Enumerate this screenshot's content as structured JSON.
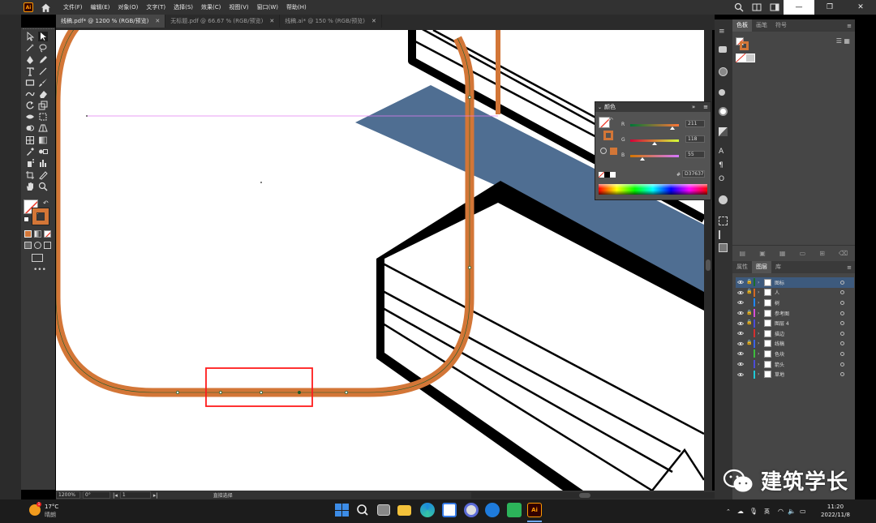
{
  "menubar": {
    "app_logo": "Ai",
    "menus": [
      "文件(F)",
      "编辑(E)",
      "对象(O)",
      "文字(T)",
      "选择(S)",
      "效果(C)",
      "视图(V)",
      "窗口(W)",
      "帮助(H)"
    ],
    "window_controls": [
      "—",
      "❐",
      "✕"
    ]
  },
  "tabs": [
    {
      "label": "线稿.pdf* @ 1200 % (RGB/预览)",
      "active": true
    },
    {
      "label": "无标题.pdf @ 66.67 % (RGB/预览)",
      "active": false
    },
    {
      "label": "线稿.ai* @ 150 % (RGB/预览)",
      "active": false
    }
  ],
  "statusbar": {
    "zoom": "1200%",
    "rotation": "0°",
    "artboard": "1",
    "status": "直接选择"
  },
  "color_panel": {
    "title": "颜色",
    "channels": [
      {
        "label": "R",
        "value": "211"
      },
      {
        "label": "G",
        "value": "118"
      },
      {
        "label": "B",
        "value": "55"
      }
    ],
    "hex": "D37637",
    "hex_prefix": "#"
  },
  "panels": {
    "top_tabs": [
      "色板",
      "画笔",
      "符号"
    ],
    "bottom_tabs": [
      "属性",
      "图层",
      "库"
    ]
  },
  "layers": [
    {
      "name": "图标",
      "color": "#1b6e2b",
      "selected": true
    },
    {
      "name": "人",
      "color": "#d46a24",
      "selected": false
    },
    {
      "name": "树",
      "color": "#1e88ff",
      "selected": false
    },
    {
      "name": "参考图",
      "color": "#d64fd6",
      "selected": false
    },
    {
      "name": "图层 4",
      "color": "#4c4cd9",
      "selected": false
    },
    {
      "name": "描边",
      "color": "#d62f2f",
      "selected": false
    },
    {
      "name": "线稿",
      "color": "#3b63e5",
      "selected": false
    },
    {
      "name": "色块",
      "color": "#3dbd3d",
      "selected": false
    },
    {
      "name": "箭头",
      "color": "#4c4cd9",
      "selected": false
    },
    {
      "name": "草地",
      "color": "#1ec9d6",
      "selected": false
    }
  ],
  "taskbar": {
    "weather_temp": "17°C",
    "weather_desc": "晴朗",
    "time": "11:20",
    "date": "2022/11/8",
    "ime": "英"
  },
  "watermark": {
    "text": "建筑学长"
  },
  "colors": {
    "orange": "#d37637",
    "slate": "#4f6e92",
    "accent_red": "#ff1c1c"
  }
}
